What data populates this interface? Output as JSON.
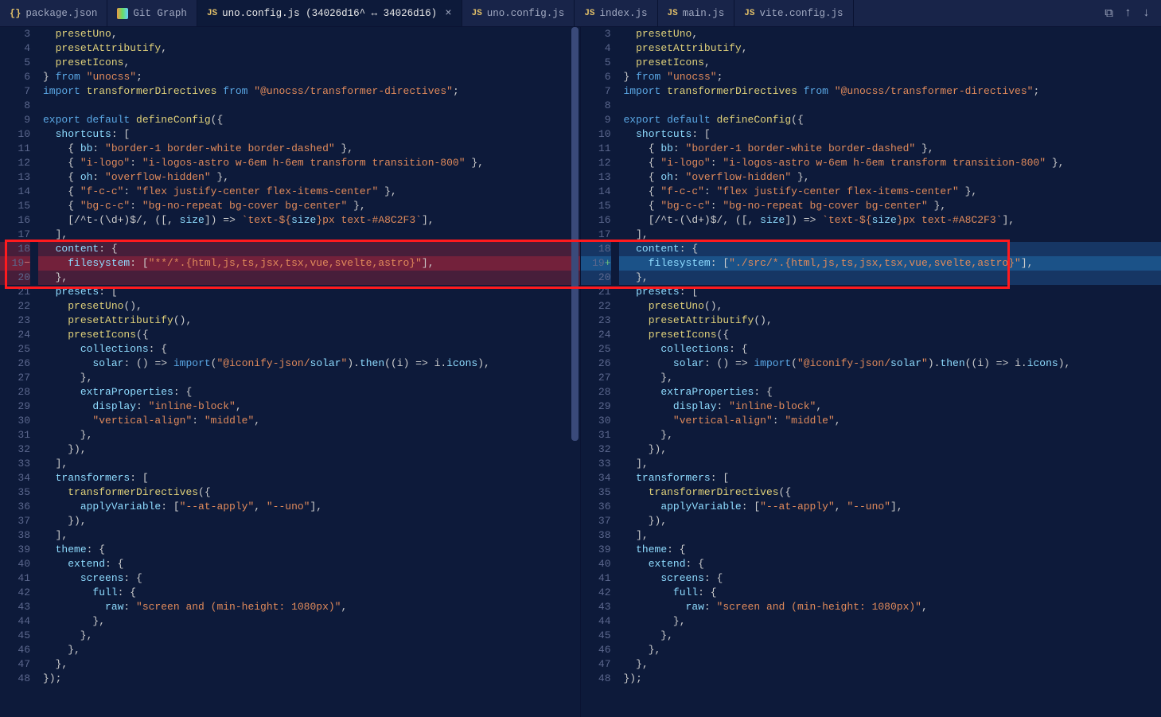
{
  "tabs": [
    {
      "icon": "json",
      "label": "package.json"
    },
    {
      "icon": "git",
      "label": "Git Graph"
    },
    {
      "icon": "js",
      "label": "uno.config.js (34026d16^ ↔ 34026d16)",
      "active": true,
      "close": true
    },
    {
      "icon": "js",
      "label": "uno.config.js"
    },
    {
      "icon": "js",
      "label": "index.js"
    },
    {
      "icon": "js",
      "label": "main.js"
    },
    {
      "icon": "js",
      "label": "vite.config.js"
    }
  ],
  "actions": {
    "diff": "⧉",
    "prev": "↑",
    "next": "↓"
  },
  "line_numbers": [
    "3",
    "4",
    "5",
    "6",
    "7",
    "8",
    "9",
    "10",
    "11",
    "12",
    "13",
    "14",
    "15",
    "16",
    "17",
    "18",
    "19",
    "20",
    "21",
    "22",
    "23",
    "24",
    "25",
    "26",
    "27",
    "28",
    "29",
    "30",
    "31",
    "32",
    "33",
    "34",
    "35",
    "36",
    "37",
    "38",
    "39",
    "40",
    "41",
    "42",
    "43",
    "44",
    "45",
    "46",
    "47",
    "48"
  ],
  "diff_marker_left": "−",
  "diff_marker_right": "+",
  "left_line19": "    filesystem: [\"**/*.{html,js,ts,jsx,tsx,vue,svelte,astro}\"],",
  "right_line19": "    filesystem: [\"./src/*.{html,js,ts,jsx,tsx,vue,svelte,astro}\"],",
  "code_common": {
    "l3": "  presetUno,",
    "l4": "  presetAttributify,",
    "l5": "  presetIcons,",
    "l6a": "} ",
    "l6b": "from",
    "l6c": " \"unocss\"",
    "l6d": ";",
    "l7a": "import",
    "l7b": " transformerDirectives ",
    "l7c": "from",
    "l7d": " \"@unocss/transformer-directives\"",
    "l7e": ";",
    "l8": "",
    "l9a": "export",
    "l9b": " default",
    "l9c": " defineConfig",
    "l9d": "({",
    "l10": "  shortcuts: [",
    "l11": "    { bb: \"border-1 border-white border-dashed\" },",
    "l12": "    { \"i-logo\": \"i-logos-astro w-6em h-6em transform transition-800\" },",
    "l13": "    { oh: \"overflow-hidden\" },",
    "l14": "    { \"f-c-c\": \"flex justify-center flex-items-center\" },",
    "l15": "    { \"bg-c-c\": \"bg-no-repeat bg-cover bg-center\" },",
    "l16": "    [/^t-(\\d+)$/, ([, size]) => `text-${size}px text-#A8C2F3`],",
    "l17": "  ],",
    "l18": "  content: {",
    "l20": "  },",
    "l21": "  presets: [",
    "l22": "    presetUno(),",
    "l23": "    presetAttributify(),",
    "l24": "    presetIcons({",
    "l25": "      collections: {",
    "l26": "        solar: () => import(\"@iconify-json/solar\").then((i) => i.icons),",
    "l27": "      },",
    "l28": "      extraProperties: {",
    "l29": "        display: \"inline-block\",",
    "l30": "        \"vertical-align\": \"middle\",",
    "l31": "      },",
    "l32": "    }),",
    "l33": "  ],",
    "l34": "  transformers: [",
    "l35": "    transformerDirectives({",
    "l36": "      applyVariable: [\"--at-apply\", \"--uno\"],",
    "l37": "    }),",
    "l38": "  ],",
    "l39": "  theme: {",
    "l40": "    extend: {",
    "l41": "      screens: {",
    "l42": "        full: {",
    "l43": "          raw: \"screen and (min-height: 1080px)\",",
    "l44": "        },",
    "l45": "      },",
    "l46": "    },",
    "l47": "  },",
    "l48": "});"
  }
}
